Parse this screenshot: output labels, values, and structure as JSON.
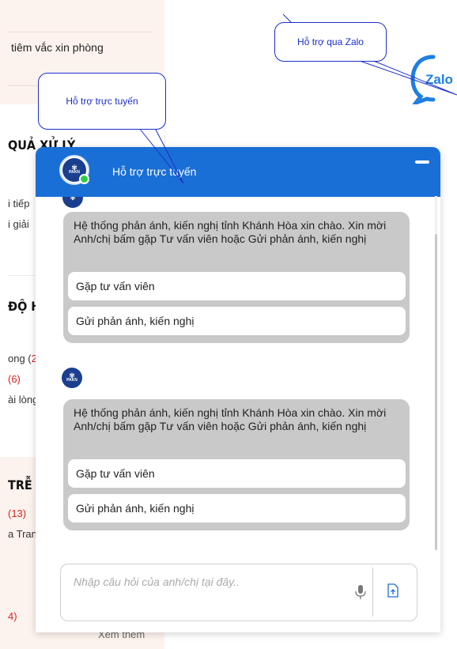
{
  "background": {
    "top_row_text": "tiêm vắc xin phòng",
    "section1_head": "QUẢ XỬ LÝ",
    "section1_lines": [
      "i tiếp",
      "i giải"
    ],
    "section2_head": "ĐỘ H",
    "section2_lines": [
      {
        "text": "ong (",
        "red": "2"
      },
      {
        "text": "",
        "red": "(6)"
      },
      {
        "text": "ài lòng",
        "red": ""
      }
    ],
    "section3_head": "TRỄ",
    "section3_lines": [
      {
        "text": "",
        "red": "(13)"
      },
      {
        "text": "a Tran",
        "red": ""
      },
      {
        "text": "",
        "red": "4)"
      }
    ],
    "see_more": "Xem thêm"
  },
  "tooltips": {
    "zalo": "Hỗ trợ qua Zalo",
    "online": "Hỗ trợ trực tuyến"
  },
  "zalo_logo_text": "Zalo",
  "chat": {
    "title": "Hỗ trợ trực tuyến",
    "avatar_text_top": "PAKN",
    "avatar_text_bottom": "KHÁNH HÒA",
    "messages": [
      {
        "text": "Hệ thống phản ánh, kiến nghị tỉnh Khánh Hòa xin chào. Xin mời Anh/chị bấm gặp Tư vấn viên hoặc Gửi phản ánh, kiến nghị",
        "options": [
          "Gặp tư vấn viên",
          "Gửi phản ánh, kiến nghị"
        ]
      },
      {
        "text": "Hệ thống phản ánh, kiến nghị tỉnh Khánh Hòa xin chào. Xin mời Anh/chị bấm gặp Tư vấn viên hoặc Gửi phản ánh, kiến nghị",
        "options": [
          "Gặp tư vấn viên",
          "Gửi phản ánh, kiến nghị"
        ]
      }
    ],
    "input_placeholder": "Nhập câu hỏi của anh/chị tại đây.."
  },
  "colors": {
    "header_blue": "#1a6fd6",
    "bubble_gray": "#c9c9c9",
    "tooltip_blue": "#1a2ecc",
    "online_green": "#2ecc40"
  }
}
